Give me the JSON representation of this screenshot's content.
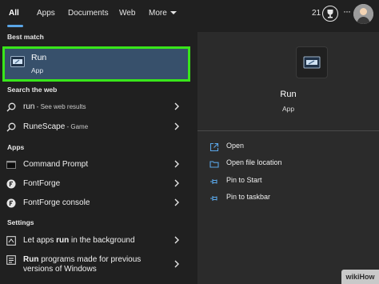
{
  "tabs": [
    {
      "label": "All",
      "active": true
    },
    {
      "label": "Apps"
    },
    {
      "label": "Documents"
    },
    {
      "label": "Web"
    },
    {
      "label": "More"
    }
  ],
  "header": {
    "points": "21"
  },
  "sections": {
    "best_match": "Best match",
    "search_web": "Search the web",
    "apps": "Apps",
    "settings": "Settings"
  },
  "best_match": {
    "title": "Run",
    "subtitle": "App"
  },
  "web_results": [
    {
      "text": "run",
      "suffix": " - See web results"
    },
    {
      "text": "RuneScape",
      "suffix": " - Game"
    }
  ],
  "apps": [
    {
      "label": "Command Prompt"
    },
    {
      "label": "FontForge"
    },
    {
      "label": "FontForge console"
    }
  ],
  "settings": [
    {
      "pre": "Let apps ",
      "bold": "run",
      "post": " in the background"
    },
    {
      "pre": "",
      "bold": "Run",
      "post": " programs made for previous versions of Windows"
    }
  ],
  "preview": {
    "title": "Run",
    "subtitle": "App",
    "actions": [
      {
        "label": "Open",
        "icon": "open-icon"
      },
      {
        "label": "Open file location",
        "icon": "folder-icon"
      },
      {
        "label": "Pin to Start",
        "icon": "pin-icon"
      },
      {
        "label": "Pin to taskbar",
        "icon": "pin-icon"
      }
    ]
  },
  "colors": {
    "highlight_border": "#39e51a",
    "selected_bg": "#37506b",
    "accent": "#5aa5e6",
    "background": "#202020",
    "preview_bg": "#2b2b2b"
  },
  "watermark": "wikiHow"
}
